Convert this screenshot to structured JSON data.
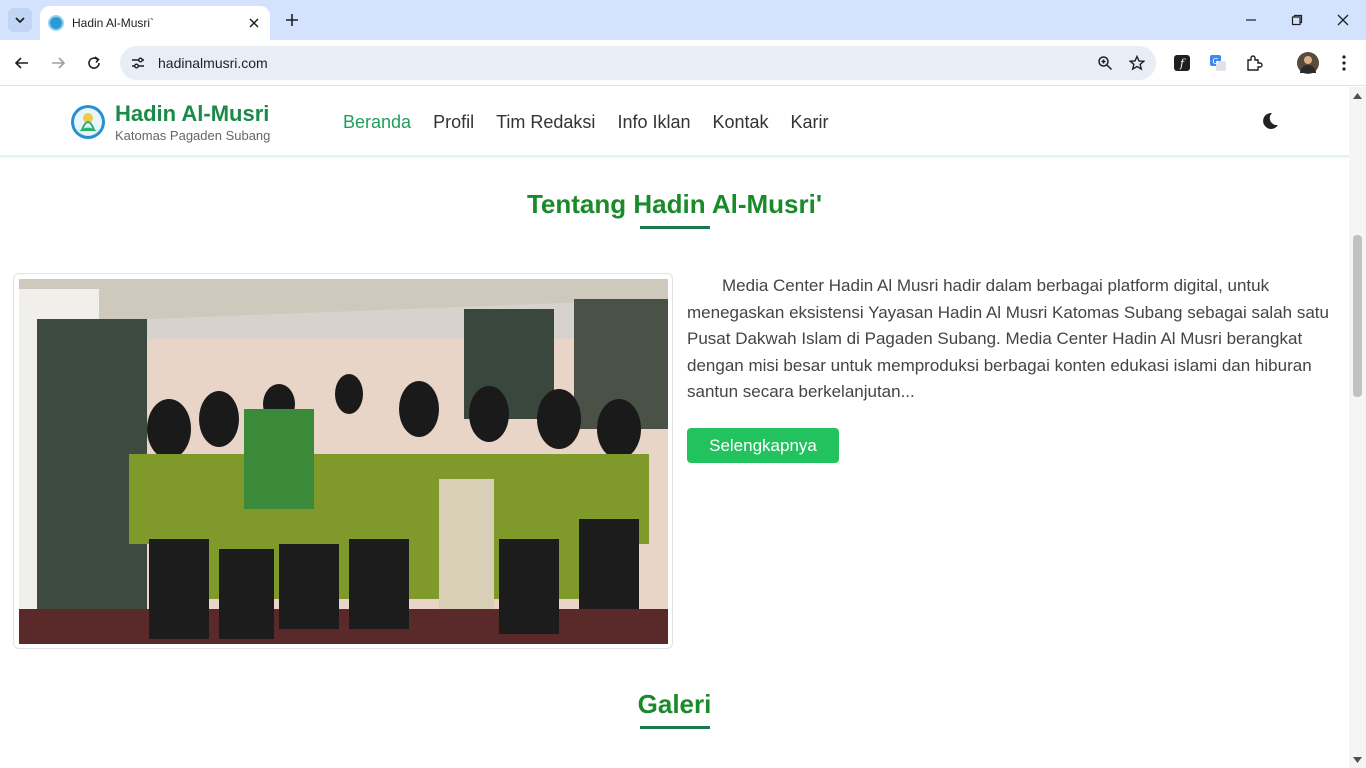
{
  "browser": {
    "tab_title": "Hadin Al-Musri`",
    "url": "hadinalmusri.com"
  },
  "site": {
    "brand_name": "Hadin Al-Musri",
    "brand_sub": "Katomas Pagaden Subang",
    "nav": [
      {
        "label": "Beranda",
        "active": true
      },
      {
        "label": "Profil",
        "active": false
      },
      {
        "label": "Tim Redaksi",
        "active": false
      },
      {
        "label": "Info Iklan",
        "active": false
      },
      {
        "label": "Kontak",
        "active": false
      },
      {
        "label": "Karir",
        "active": false
      }
    ],
    "accent_color": "#1f9e5a"
  },
  "about": {
    "title": "Tentang Hadin Al-Musri'",
    "text": "Media Center Hadin Al Musri hadir dalam berbagai platform digital, untuk menegaskan eksistensi Yayasan Hadin Al Musri Katomas Subang sebagai salah satu Pusat Dakwah Islam di Pagaden Subang. Media Center Hadin Al Musri berangkat dengan misi besar untuk memproduksi berbagai konten edukasi islami dan hiburan santun secara berkelanjutan...",
    "button_label": "Selengkapnya"
  },
  "gallery": {
    "title": "Galeri"
  }
}
